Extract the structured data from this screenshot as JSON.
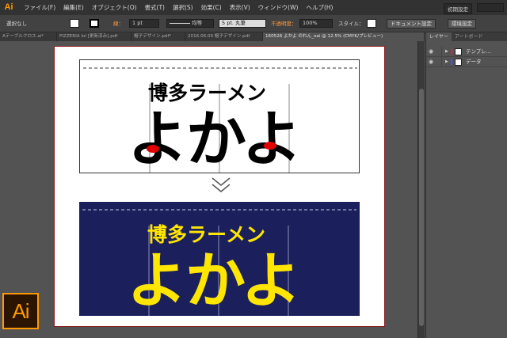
{
  "menubar": {
    "app_icon": "Ai",
    "items": [
      "ファイル(F)",
      "編集(E)",
      "オブジェクト(O)",
      "書式(T)",
      "選択(S)",
      "効果(C)",
      "表示(V)",
      "ウィンドウ(W)",
      "ヘルプ(H)"
    ],
    "workspace": "初期設定"
  },
  "control": {
    "selection": "選択なし",
    "stroke_label": "線：",
    "stroke_weight": "1 pt",
    "profile": "均等",
    "brush": "5 pt. 丸筆",
    "opacity_label": "不透明度：",
    "opacity": "100%",
    "style_label": "スタイル：",
    "doc_setup": "ドキュメント設定",
    "env_setup": "環境設定",
    "fill_color": "#ffffff",
    "stroke_color": "#000000"
  },
  "tabs": [
    {
      "label": "Aテーブルクロス.ai*"
    },
    {
      "label": "PIZZERIA lol [更新済み].pdf"
    },
    {
      "label": "帽子デザイン.pdf*"
    },
    {
      "label": "2016.06.09 帽子デザイン.pdf"
    },
    {
      "label": "160526 よかよ のれん_oai @ 12.5% (CMYK/プレビュー)"
    }
  ],
  "artwork": {
    "line1": "博多ラーメン",
    "line2": "よかよ",
    "black_color": "#000000",
    "red_color": "#e00000",
    "navy_color": "#1b1f5c",
    "yellow_color": "#ffe600"
  },
  "panel": {
    "tabs": [
      "レイヤー",
      "アートボード"
    ],
    "layers": [
      {
        "name": "テンプレ...",
        "color": "#e0233a"
      },
      {
        "name": "データ",
        "color": "#3a5bff"
      }
    ]
  },
  "badge": "Ai"
}
